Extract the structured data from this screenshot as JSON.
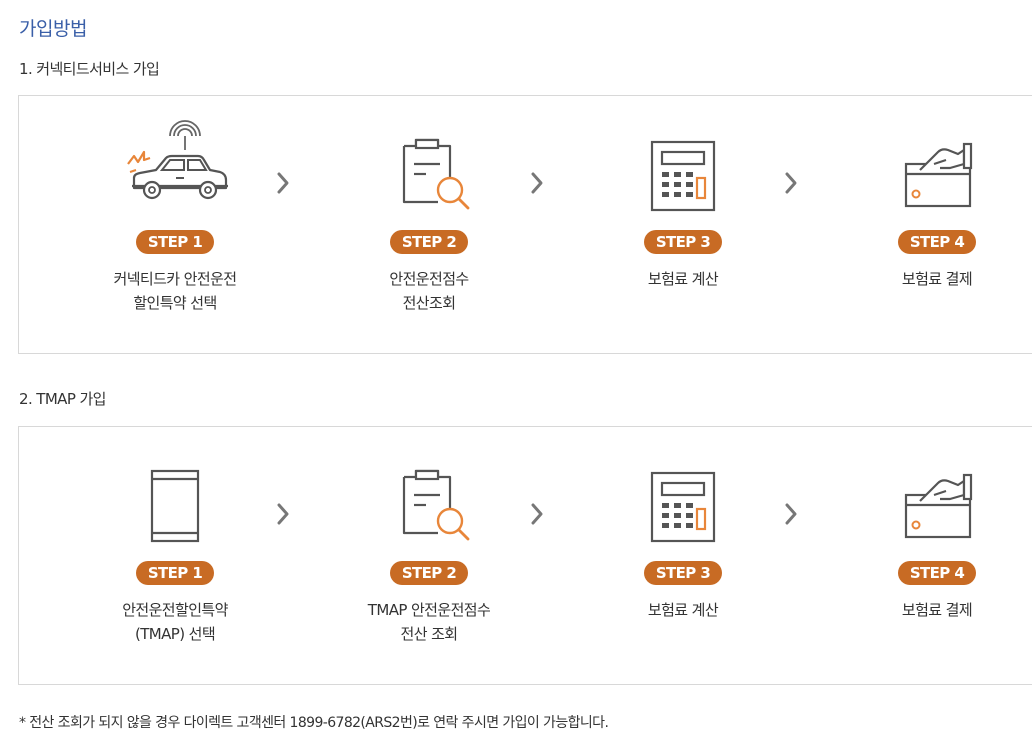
{
  "page_title": "가입방법",
  "sections": [
    {
      "title": "1. 커넥티드서비스 가입",
      "steps": [
        {
          "badge": "STEP 1",
          "lines": [
            "커넥티드카 안전운전",
            "할인특약 선택"
          ],
          "icon": "connected-car-icon"
        },
        {
          "badge": "STEP 2",
          "lines": [
            "안전운전점수",
            "전산조회"
          ],
          "icon": "clipboard-search-icon"
        },
        {
          "badge": "STEP 3",
          "lines": [
            "보험료 계산",
            ""
          ],
          "icon": "calculator-icon"
        },
        {
          "badge": "STEP 4",
          "lines": [
            "보험료 결제",
            ""
          ],
          "icon": "card-payment-icon"
        }
      ]
    },
    {
      "title": "2. TMAP 가입",
      "steps": [
        {
          "badge": "STEP 1",
          "lines": [
            "안전운전할인특약",
            "(TMAP) 선택"
          ],
          "icon": "smartphone-icon"
        },
        {
          "badge": "STEP 2",
          "lines": [
            "TMAP 안전운전점수",
            "전산 조회"
          ],
          "icon": "clipboard-search-icon"
        },
        {
          "badge": "STEP 3",
          "lines": [
            "보험료 계산",
            ""
          ],
          "icon": "calculator-icon"
        },
        {
          "badge": "STEP 4",
          "lines": [
            "보험료 결제",
            ""
          ],
          "icon": "card-payment-icon"
        }
      ]
    }
  ],
  "footnote": "* 전산 조회가 되지 않을 경우 다이렉트 고객센터 1899-6782(ARS2번)로 연락 주시면 가입이 가능합니다.",
  "colors": {
    "title": "#3a5fa8",
    "badge": "#c86b24",
    "accent_orange": "#e8863a",
    "icon_stroke": "#555555",
    "border": "#d8d8d8"
  }
}
